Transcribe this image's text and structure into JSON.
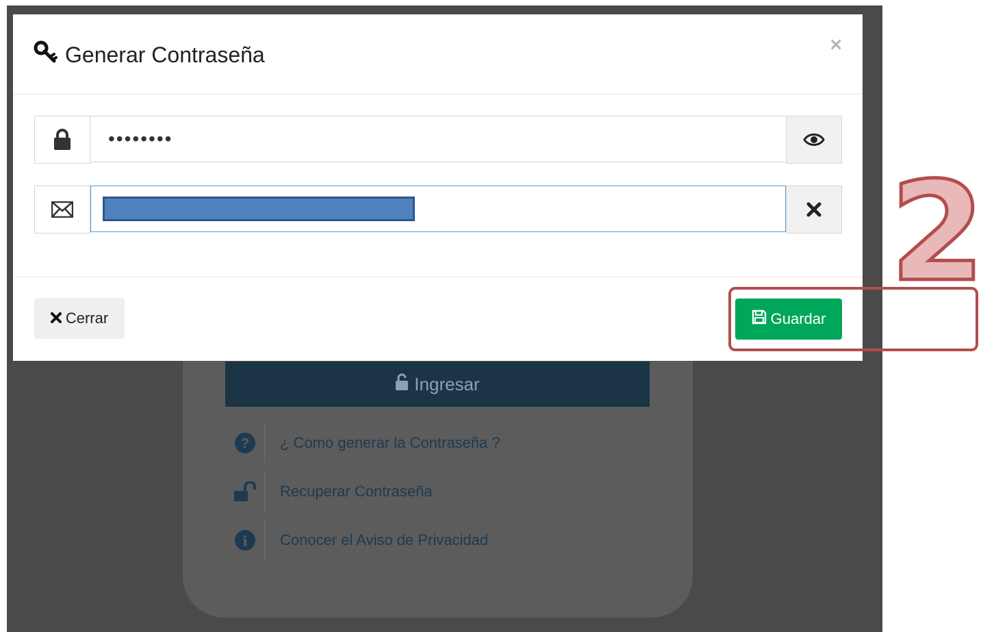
{
  "modal": {
    "title": "Generar Contraseña",
    "title_icon": "key-icon",
    "close_symbol": "×",
    "password": {
      "icon": "lock-icon",
      "value_masked": "••••••••",
      "toggle_icon": "eye-icon"
    },
    "email": {
      "icon": "envelope-icon",
      "clear_icon": "times-icon",
      "value_redacted": true
    },
    "buttons": {
      "close_label": "Cerrar",
      "save_label": "Guardar"
    }
  },
  "background": {
    "login_button_label": "Ingresar",
    "links": [
      {
        "icon": "question-circle-icon",
        "label": "¿ Como generar la Contraseña ?"
      },
      {
        "icon": "unlock-icon",
        "label": "Recuperar Contraseña"
      },
      {
        "icon": "info-circle-icon",
        "label": "Conocer el Aviso de Privacidad"
      }
    ]
  },
  "annotation": {
    "step_number": "2",
    "highlight_color": "#b34d4d"
  },
  "colors": {
    "save_button": "#00a65a",
    "login_button": "#1b3446",
    "link_text": "#1d3a52"
  }
}
